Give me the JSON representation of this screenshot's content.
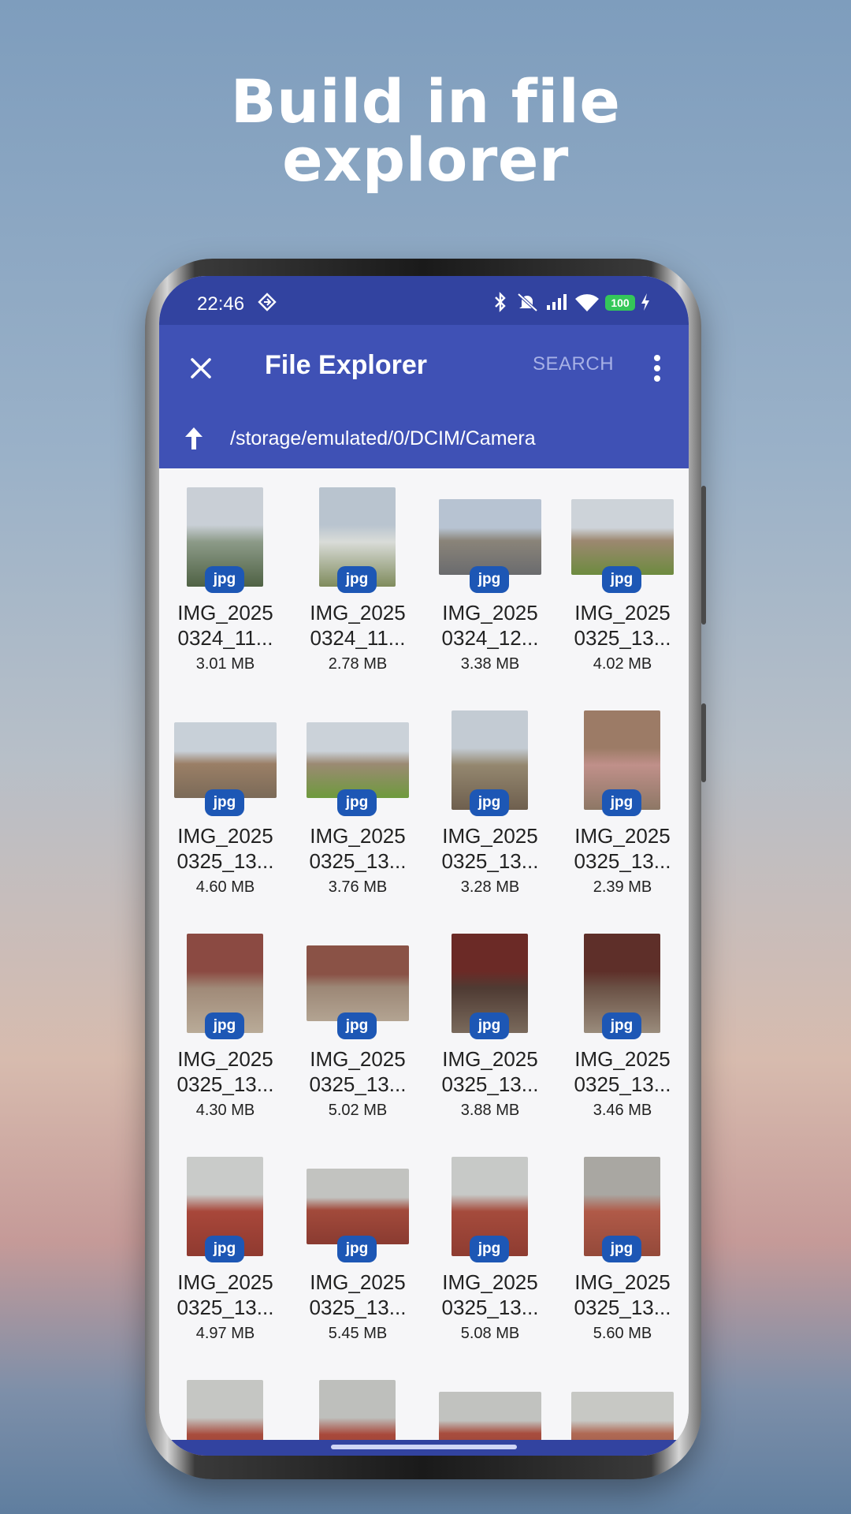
{
  "headline": {
    "line1": "Build in file",
    "line2": "explorer"
  },
  "status_bar": {
    "time": "22:46",
    "battery": "100"
  },
  "app_bar": {
    "title": "File Explorer",
    "search_label": "SEARCH",
    "path": "/storage/emulated/0/DCIM/Camera"
  },
  "files": [
    {
      "name1": "IMG_2025",
      "name2": "0324_11...",
      "size": "3.01 MB",
      "type": "jpg",
      "colors": [
        "#c9cfd6",
        "#8c9a88",
        "#4f6244"
      ]
    },
    {
      "name1": "IMG_2025",
      "name2": "0324_11...",
      "size": "2.78 MB",
      "type": "jpg",
      "colors": [
        "#b9c4cf",
        "#d9dcd8",
        "#7f8b5c"
      ]
    },
    {
      "name1": "IMG_2025",
      "name2": "0324_12...",
      "size": "3.38 MB",
      "type": "jpg",
      "colors": [
        "#b7c3d2",
        "#8a8479",
        "#6a6b6e"
      ]
    },
    {
      "name1": "IMG_2025",
      "name2": "0325_13...",
      "size": "4.02 MB",
      "type": "jpg",
      "colors": [
        "#cdd3d9",
        "#9c8870",
        "#6d8b3f"
      ]
    },
    {
      "name1": "IMG_2025",
      "name2": "0325_13...",
      "size": "4.60 MB",
      "type": "jpg",
      "colors": [
        "#c8d0d8",
        "#9a7f66",
        "#7b6a58"
      ]
    },
    {
      "name1": "IMG_2025",
      "name2": "0325_13...",
      "size": "3.76 MB",
      "type": "jpg",
      "colors": [
        "#cbd2d9",
        "#9b8a73",
        "#6e9a3d"
      ]
    },
    {
      "name1": "IMG_2025",
      "name2": "0325_13...",
      "size": "3.28 MB",
      "type": "jpg",
      "colors": [
        "#c3cbd3",
        "#94876f",
        "#6e5f4e"
      ]
    },
    {
      "name1": "IMG_2025",
      "name2": "0325_13...",
      "size": "2.39 MB",
      "type": "jpg",
      "colors": [
        "#9c7b66",
        "#c0908a",
        "#8d7765"
      ]
    },
    {
      "name1": "IMG_2025",
      "name2": "0325_13...",
      "size": "4.30 MB",
      "type": "jpg",
      "colors": [
        "#8b4a42",
        "#a08a78",
        "#b9ab98"
      ]
    },
    {
      "name1": "IMG_2025",
      "name2": "0325_13...",
      "size": "5.02 MB",
      "type": "jpg",
      "colors": [
        "#8a5246",
        "#9c8776",
        "#b3a492"
      ]
    },
    {
      "name1": "IMG_2025",
      "name2": "0325_13...",
      "size": "3.88 MB",
      "type": "jpg",
      "colors": [
        "#6b2a26",
        "#4f3b33",
        "#7a6a5c"
      ]
    },
    {
      "name1": "IMG_2025",
      "name2": "0325_13...",
      "size": "3.46 MB",
      "type": "jpg",
      "colors": [
        "#5e2f29",
        "#6b5246",
        "#9a8c7c"
      ]
    },
    {
      "name1": "IMG_2025",
      "name2": "0325_13...",
      "size": "4.97 MB",
      "type": "jpg",
      "colors": [
        "#c9cbc9",
        "#a8473a",
        "#8f3a30"
      ]
    },
    {
      "name1": "IMG_2025",
      "name2": "0325_13...",
      "size": "5.45 MB",
      "type": "jpg",
      "colors": [
        "#c2c3c0",
        "#a24a3b",
        "#8a3b31"
      ]
    },
    {
      "name1": "IMG_2025",
      "name2": "0325_13...",
      "size": "5.08 MB",
      "type": "jpg",
      "colors": [
        "#c7c9c7",
        "#a54b3c",
        "#8e3c31"
      ]
    },
    {
      "name1": "IMG_2025",
      "name2": "0325_13...",
      "size": "5.60 MB",
      "type": "jpg",
      "colors": [
        "#a9a7a2",
        "#b05a48",
        "#94493a"
      ]
    },
    {
      "name1": "",
      "name2": "",
      "size": "",
      "type": "",
      "colors": [
        "#c5c6c3",
        "#a84c3d",
        "#8e3c31"
      ]
    },
    {
      "name1": "",
      "name2": "",
      "size": "",
      "type": "",
      "colors": [
        "#bebfbc",
        "#a8493b",
        "#8c3b30"
      ]
    },
    {
      "name1": "",
      "name2": "",
      "size": "",
      "type": "",
      "colors": [
        "#c1c2bf",
        "#a84d3e",
        "#8c3d32"
      ]
    },
    {
      "name1": "",
      "name2": "",
      "size": "",
      "type": "",
      "colors": [
        "#c7c8c4",
        "#b06a55",
        "#8d4a3a"
      ]
    }
  ]
}
